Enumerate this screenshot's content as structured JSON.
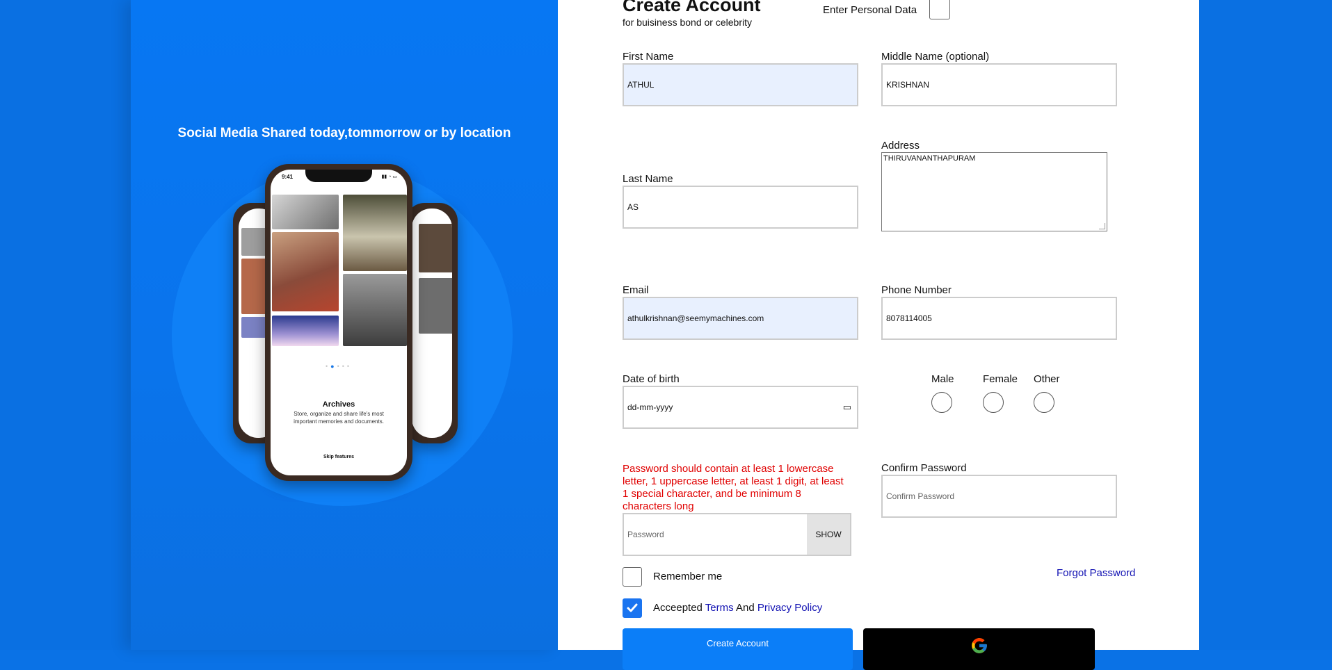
{
  "left": {
    "tagline": "Social Media Shared today,tommorrow or by location",
    "phone": {
      "time": "9:41",
      "card_title": "Archives",
      "card_description": "Store, organize and share life's most important memories and documents.",
      "skip_label": "Skip features"
    }
  },
  "form": {
    "title": "Create Account",
    "subtitle": "for buisiness bond or celebrity",
    "personal_data_label": "Enter Personal Data",
    "first_name": {
      "label": "First Name",
      "value": "ATHUL"
    },
    "middle_name": {
      "label": "Middle Name (optional)",
      "value": "KRISHNAN"
    },
    "last_name": {
      "label": "Last Name",
      "value": "AS"
    },
    "address": {
      "label": "Address",
      "value": "THIRUVANANTHAPURAM"
    },
    "email": {
      "label": "Email",
      "value": "athulkrishnan@seemymachines.com"
    },
    "phone": {
      "label": "Phone Number",
      "value": "8078114005"
    },
    "dob": {
      "label": "Date of birth",
      "placeholder": "dd-mm-yyyy"
    },
    "gender": {
      "options": [
        "Male",
        "Female",
        "Other"
      ]
    },
    "password_hint": "Password should contain at least 1 lowercase letter, 1 uppercase letter, at least 1 digit, at least 1 special character, and be minimum 8 characters long",
    "password": {
      "placeholder": "Password",
      "show_label": "SHOW"
    },
    "confirm_password": {
      "label": "Confirm Password",
      "placeholder": "Confirm Password"
    },
    "remember_me": "Remember me",
    "forgot_password": "Forgot Password",
    "terms": {
      "prefix": "Acceepted",
      "terms_link": "Terms",
      "and": "And",
      "privacy_link": "Privacy Policy",
      "checked": true
    },
    "create_button": "Create Account"
  },
  "colors": {
    "brand_blue": "#0a74ec",
    "primary_button": "#0b7ef8",
    "error_red": "#e00000",
    "link_blue": "#1212b3"
  }
}
